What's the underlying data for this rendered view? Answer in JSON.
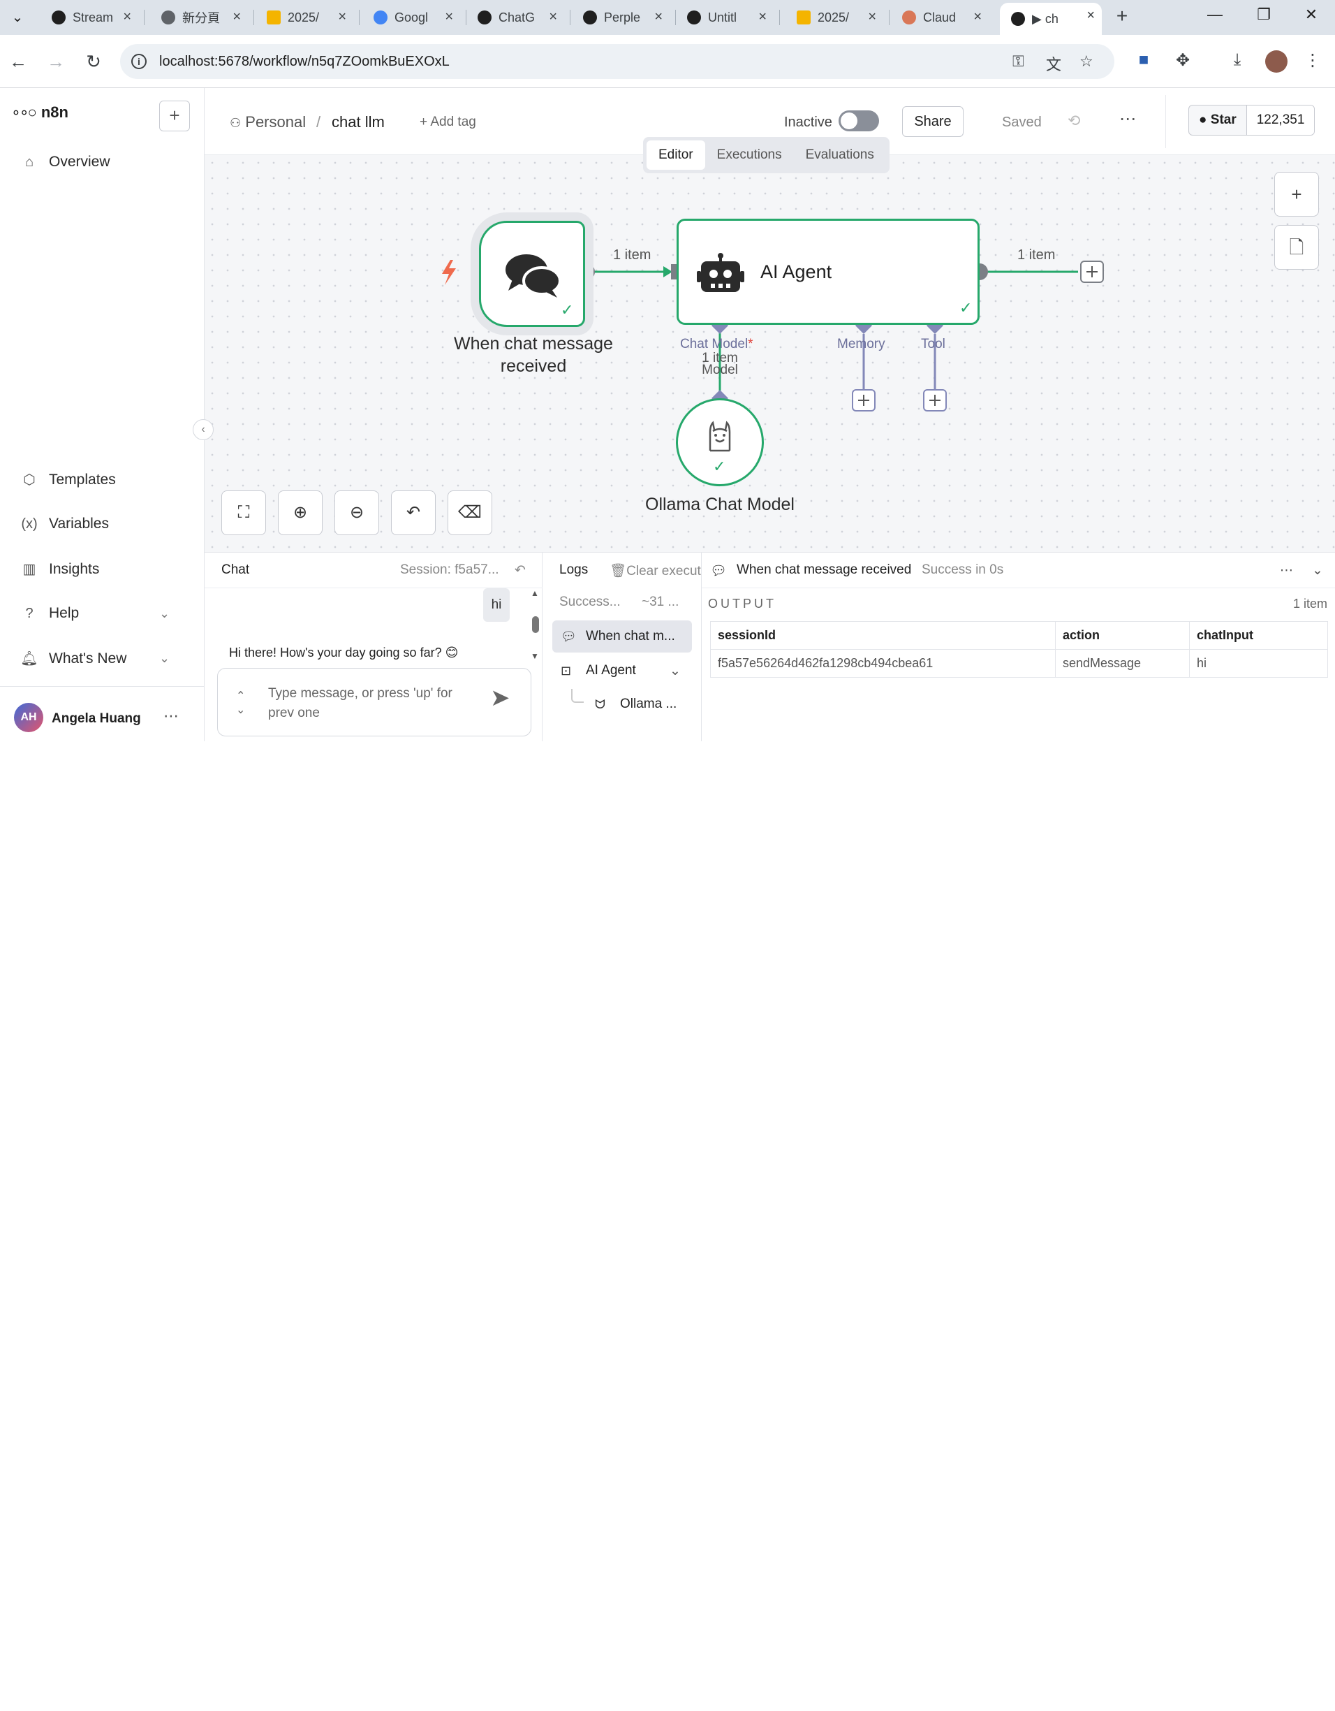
{
  "browser": {
    "tabs": [
      {
        "title": "Stream",
        "color": "#1f1f1f"
      },
      {
        "title": "新分頁",
        "color": "#5f6368"
      },
      {
        "title": "2025/",
        "color": "#f4b400"
      },
      {
        "title": "Googl",
        "color": "#4285f4"
      },
      {
        "title": "ChatG",
        "color": "#1f1f1f"
      },
      {
        "title": "Perple",
        "color": "#1f1f1f"
      },
      {
        "title": "Untitl",
        "color": "#1f1f1f"
      },
      {
        "title": "2025/",
        "color": "#f4b400"
      },
      {
        "title": "Claud",
        "color": "#d97757"
      },
      {
        "title": "▶ ch",
        "color": "#1f1f1f"
      }
    ],
    "url": "localhost:5678/workflow/n5q7ZOomkBuEXOxL"
  },
  "sidebar": {
    "brand": "n8n",
    "items": [
      {
        "label": "Overview",
        "icon": "home-icon"
      },
      {
        "label": "Templates",
        "icon": "box-icon"
      },
      {
        "label": "Variables",
        "icon": "variable-icon"
      },
      {
        "label": "Insights",
        "icon": "chart-icon"
      },
      {
        "label": "Help",
        "icon": "help-icon"
      },
      {
        "label": "What's New",
        "icon": "bell-icon"
      }
    ],
    "user": {
      "initials": "AH",
      "name": "Angela Huang"
    }
  },
  "header": {
    "project": "Personal",
    "workflow_name": "chat llm",
    "add_tag": "+ Add tag",
    "status_label": "Inactive",
    "share": "Share",
    "saved": "Saved",
    "github_star": "Star",
    "github_count": "122,351"
  },
  "view_tabs": [
    "Editor",
    "Executions",
    "Evaluations"
  ],
  "canvas": {
    "trigger_label": "When chat message received",
    "trigger_label_line1": "When chat message",
    "trigger_label_line2": "received",
    "agent_label": "AI Agent",
    "ollama_label": "Ollama Chat Model",
    "conn_in": "1 item",
    "conn_out": "1 item",
    "sub_chat_model": "Chat Model",
    "sub_chat_required": "*",
    "sub_memory": "Memory",
    "sub_tool": "Tool",
    "model_conn_line1": "1 item",
    "model_conn_line2": "Model",
    "accent_green": "#26a86b",
    "subnode_color": "#8388b8"
  },
  "chat": {
    "title": "Chat",
    "session": "Session: f5a57...",
    "user_message": "hi",
    "bot_message": "Hi there! How's your day going so far? 😊",
    "input_placeholder": "Type message, or press 'up' for prev one"
  },
  "logs": {
    "title": "Logs",
    "clear": "Clear execut",
    "status": "Success...",
    "time": "~31 ...",
    "items": [
      {
        "label": "When chat m...",
        "icon": "chat-icon"
      },
      {
        "label": "AI Agent",
        "icon": "robot-icon"
      },
      {
        "label": "Ollama ...",
        "icon": "llama-icon"
      }
    ]
  },
  "output": {
    "node_title": "When chat message received",
    "status": "Success in 0s",
    "section": "OUTPUT",
    "count": "1 item",
    "columns": [
      "sessionId",
      "action",
      "chatInput"
    ],
    "rows": [
      [
        "f5a57e56264d462fa1298cb494cbea61",
        "sendMessage",
        "hi"
      ]
    ]
  }
}
